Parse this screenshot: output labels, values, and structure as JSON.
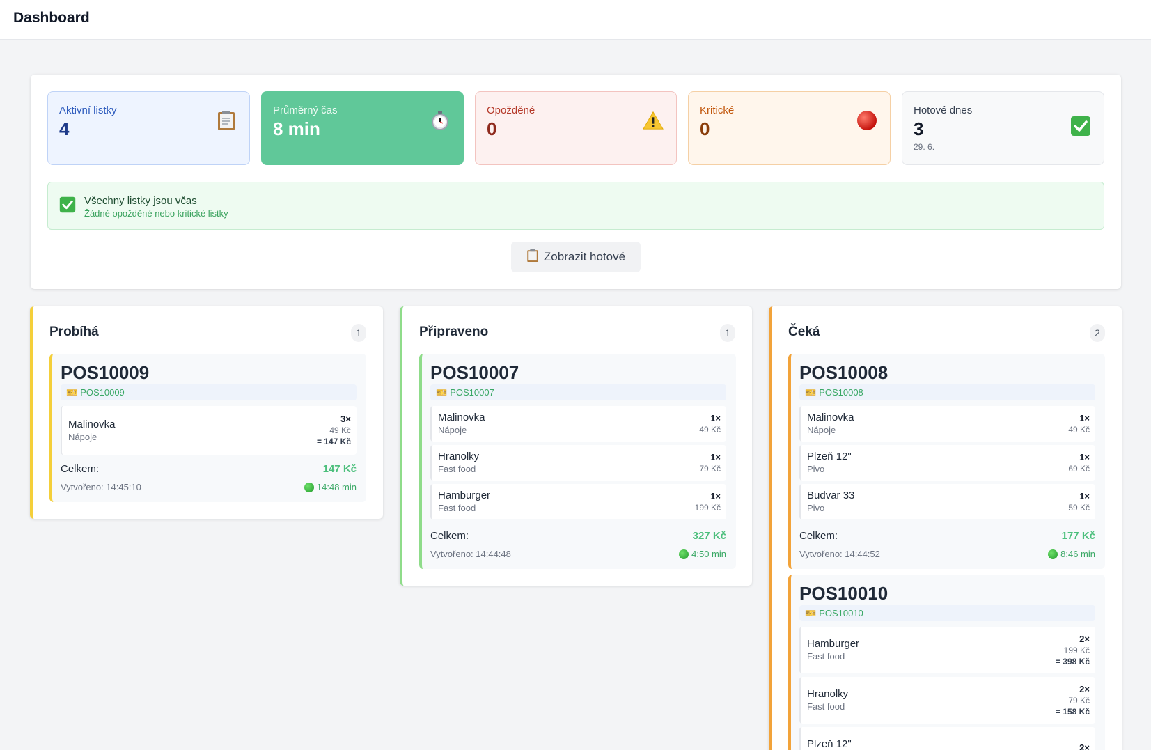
{
  "header": {
    "title": "Dashboard"
  },
  "stats": [
    {
      "label": "Aktivní listky",
      "value": "4",
      "icon": "clipboard-icon"
    },
    {
      "label": "Průměrný čas",
      "value": "8 min",
      "icon": "stopwatch-icon"
    },
    {
      "label": "Opožděné",
      "value": "0",
      "icon": "warning-icon"
    },
    {
      "label": "Kritické",
      "value": "0",
      "icon": "red-circle-icon"
    },
    {
      "label": "Hotové dnes",
      "value": "3",
      "sub": "29. 6.",
      "icon": "check-icon"
    }
  ],
  "alert": {
    "title": "Všechny listky jsou včas",
    "subtitle": "Žádné opožděné nebo kritické listky"
  },
  "show_done_button": "Zobrazit hotové",
  "summary_label": "Celkem:",
  "columns": [
    {
      "title": "Probíhá",
      "count": "1",
      "accent": "#f4cf3a",
      "tickets": [
        {
          "id": "POS10009",
          "source": "POS10009",
          "items": [
            {
              "name": "Malinovka",
              "category": "Nápoje",
              "qty": "3×",
              "price": "49 Kč",
              "total": "= 147 Kč"
            }
          ],
          "total": "147 Kč",
          "created": "Vytvořeno: 14:45:10",
          "time": "14:48 min"
        }
      ]
    },
    {
      "title": "Připraveno",
      "count": "1",
      "accent": "#8fdc8a",
      "tickets": [
        {
          "id": "POS10007",
          "source": "POS10007",
          "items": [
            {
              "name": "Malinovka",
              "category": "Nápoje",
              "qty": "1×",
              "price": "49 Kč"
            },
            {
              "name": "Hranolky",
              "category": "Fast food",
              "qty": "1×",
              "price": "79 Kč"
            },
            {
              "name": "Hamburger",
              "category": "Fast food",
              "qty": "1×",
              "price": "199 Kč"
            }
          ],
          "total": "327 Kč",
          "created": "Vytvořeno: 14:44:48",
          "time": "4:50 min"
        }
      ]
    },
    {
      "title": "Čeká",
      "count": "2",
      "accent": "#f2a33a",
      "tickets": [
        {
          "id": "POS10008",
          "source": "POS10008",
          "items": [
            {
              "name": "Malinovka",
              "category": "Nápoje",
              "qty": "1×",
              "price": "49 Kč"
            },
            {
              "name": "Plzeň 12\"",
              "category": "Pivo",
              "qty": "1×",
              "price": "69 Kč"
            },
            {
              "name": "Budvar 33",
              "category": "Pivo",
              "qty": "1×",
              "price": "59 Kč"
            }
          ],
          "total": "177 Kč",
          "created": "Vytvořeno: 14:44:52",
          "time": "8:46 min"
        },
        {
          "id": "POS10010",
          "source": "POS10010",
          "items": [
            {
              "name": "Hamburger",
              "category": "Fast food",
              "qty": "2×",
              "price": "199 Kč",
              "total": "= 398 Kč"
            },
            {
              "name": "Hranolky",
              "category": "Fast food",
              "qty": "2×",
              "price": "79 Kč",
              "total": "= 158 Kč"
            },
            {
              "name": "Plzeň 12\"",
              "category": "",
              "qty": "2×",
              "price": "",
              "total": ""
            }
          ]
        }
      ]
    }
  ]
}
